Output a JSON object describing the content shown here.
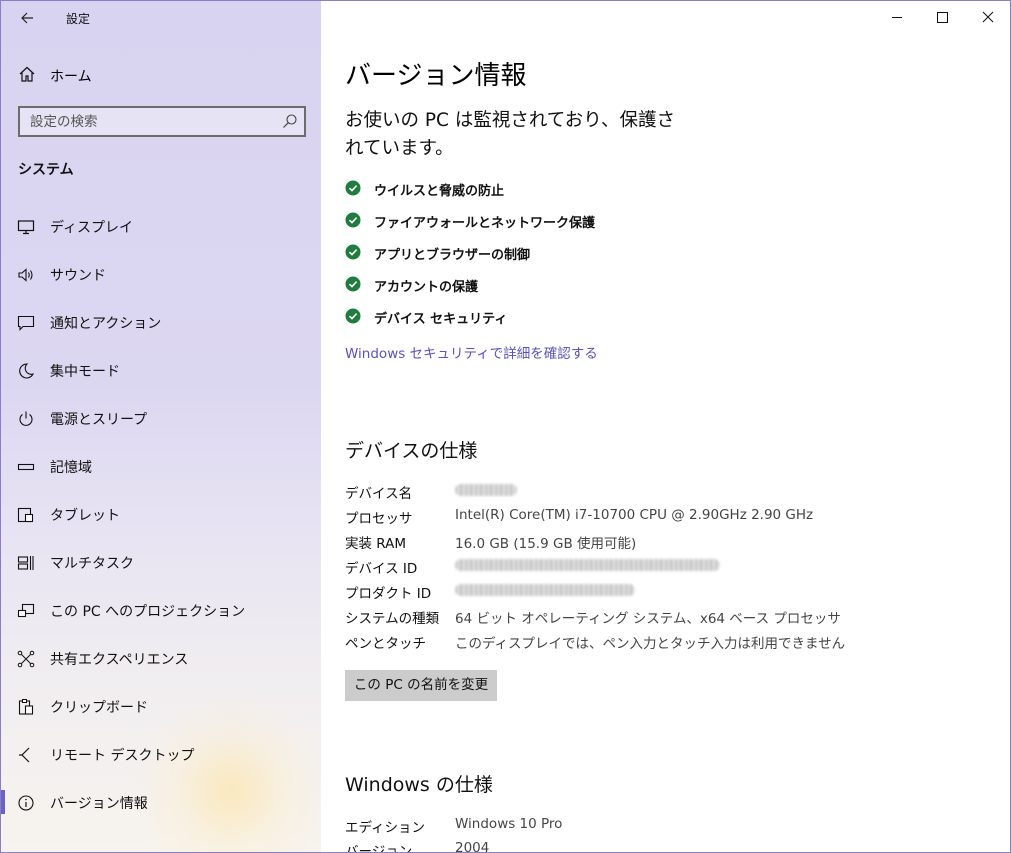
{
  "window": {
    "title": "設定",
    "back_icon": "arrow-left-icon",
    "controls": [
      "minimize-icon",
      "maximize-icon",
      "close-icon"
    ]
  },
  "sidebar": {
    "home_label": "ホーム",
    "search_placeholder": "設定の検索",
    "section_title": "システム",
    "items": [
      {
        "label": "ディスプレイ",
        "icon": "monitor-icon"
      },
      {
        "label": "サウンド",
        "icon": "speaker-icon"
      },
      {
        "label": "通知とアクション",
        "icon": "message-icon"
      },
      {
        "label": "集中モード",
        "icon": "moon-icon"
      },
      {
        "label": "電源とスリープ",
        "icon": "power-icon"
      },
      {
        "label": "記憶域",
        "icon": "storage-icon"
      },
      {
        "label": "タブレット",
        "icon": "tablet-icon"
      },
      {
        "label": "マルチタスク",
        "icon": "multitask-icon"
      },
      {
        "label": "この PC へのプロジェクション",
        "icon": "projection-icon"
      },
      {
        "label": "共有エクスペリエンス",
        "icon": "share-icon"
      },
      {
        "label": "クリップボード",
        "icon": "clipboard-icon"
      },
      {
        "label": "リモート デスクトップ",
        "icon": "remote-icon"
      },
      {
        "label": "バージョン情報",
        "icon": "info-icon",
        "selected": true
      }
    ]
  },
  "main": {
    "title": "バージョン情報",
    "protection_status": "お使いの PC は監視されており、保護されています。",
    "security_items": [
      "ウイルスと脅威の防止",
      "ファイアウォールとネットワーク保護",
      "アプリとブラウザーの制御",
      "アカウントの保護",
      "デバイス セキュリティ"
    ],
    "security_link": "Windows セキュリティで詳細を確認する",
    "device_specs_title": "デバイスの仕様",
    "device_specs": [
      {
        "key": "デバイス名",
        "value": ""
      },
      {
        "key": "プロセッサ",
        "value": "Intel(R) Core(TM) i7-10700 CPU @ 2.90GHz   2.90 GHz"
      },
      {
        "key": "実装 RAM",
        "value": "16.0 GB (15.9 GB 使用可能)"
      },
      {
        "key": "デバイス ID",
        "value": ""
      },
      {
        "key": "プロダクト ID",
        "value": ""
      },
      {
        "key": "システムの種類",
        "value": "64 ビット オペレーティング システム、x64 ベース プロセッサ"
      },
      {
        "key": "ペンとタッチ",
        "value": "このディスプレイでは、ペン入力とタッチ入力は利用できません"
      }
    ],
    "rename_button": "この PC の名前を変更",
    "windows_specs_title": "Windows の仕様",
    "windows_specs": [
      {
        "key": "エディション",
        "value": "Windows 10 Pro"
      },
      {
        "key": "バージョン",
        "value": "2004"
      }
    ],
    "colors": {
      "accent": "#6b62c8",
      "check_green": "#1e7d3c",
      "link": "#5a50c0"
    }
  }
}
